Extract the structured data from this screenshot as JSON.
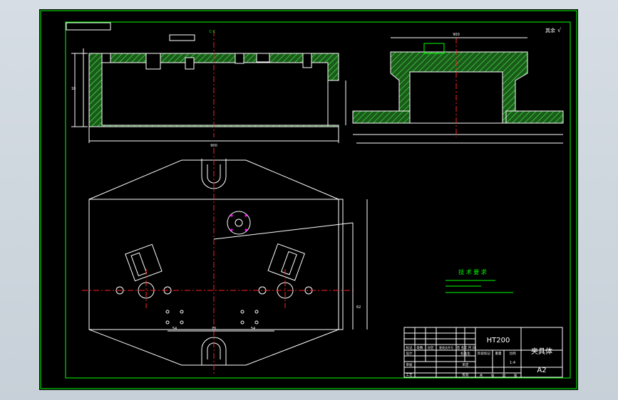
{
  "drawing": {
    "material": "HT200",
    "part_name": "夹具体",
    "sheet_size": "A2",
    "scale": "1:4",
    "surface_mark": "其余",
    "section_label": "C-C",
    "technical_requirements": {
      "title": "技 术 要 求"
    }
  },
  "title_block": {
    "row_labels": [
      "标记",
      "处数",
      "分区",
      "更改文件号",
      "签 名",
      "年 月 日"
    ],
    "side_labels": [
      "设计",
      "审核",
      "工艺"
    ],
    "mid_labels": [
      "标准化",
      "审定",
      "批准"
    ],
    "bottom_labels": [
      "共",
      "张",
      "第",
      "张"
    ],
    "stage_labels": [
      "阶段标记",
      "重量",
      "比例"
    ]
  },
  "dims": {
    "top_view_width": "900",
    "hole_pitch_1": "54",
    "hole_pitch_2": "70",
    "hole_pitch_3": "54",
    "right_height": "62",
    "left_offset": "18",
    "section_width": "900"
  },
  "colors": {
    "background": "#000000",
    "frame": "#00ff00",
    "lines": "#ffffff",
    "center_lines": "#ff2020",
    "notes": "#00ff00"
  }
}
